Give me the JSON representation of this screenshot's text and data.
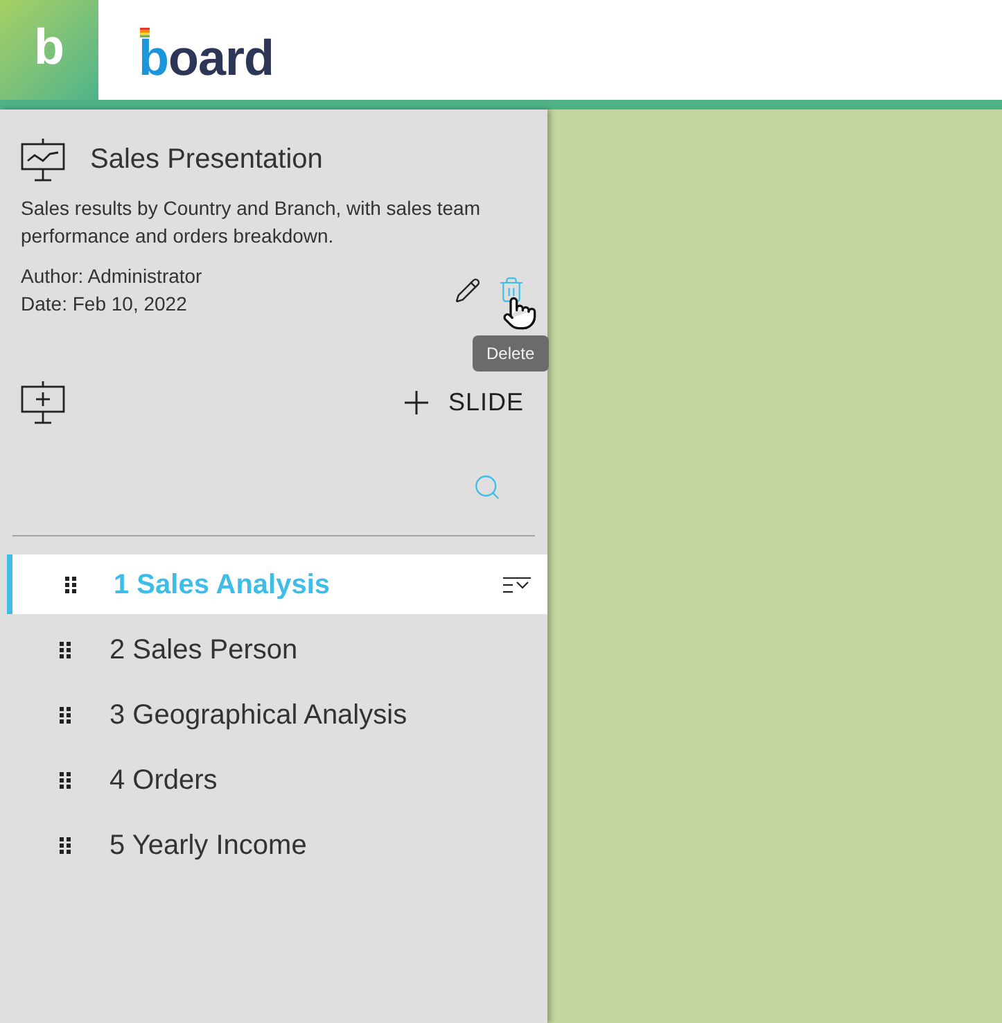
{
  "header": {
    "logo_mark": "b",
    "wordmark": "board"
  },
  "presentation": {
    "title": "Sales Presentation",
    "description": "Sales results by Country and Branch, with sales team performance and orders breakdown.",
    "author": "Author: Administrator",
    "date": "Date: Feb 10, 2022",
    "tooltip": "Delete"
  },
  "add_slide": {
    "label": "SLIDE"
  },
  "slides": [
    {
      "label": "1 Sales Analysis",
      "selected": true
    },
    {
      "label": "2 Sales Person",
      "selected": false
    },
    {
      "label": "3 Geographical Analysis",
      "selected": false
    },
    {
      "label": "4 Orders",
      "selected": false
    },
    {
      "label": "5 Yearly Income",
      "selected": false
    }
  ]
}
